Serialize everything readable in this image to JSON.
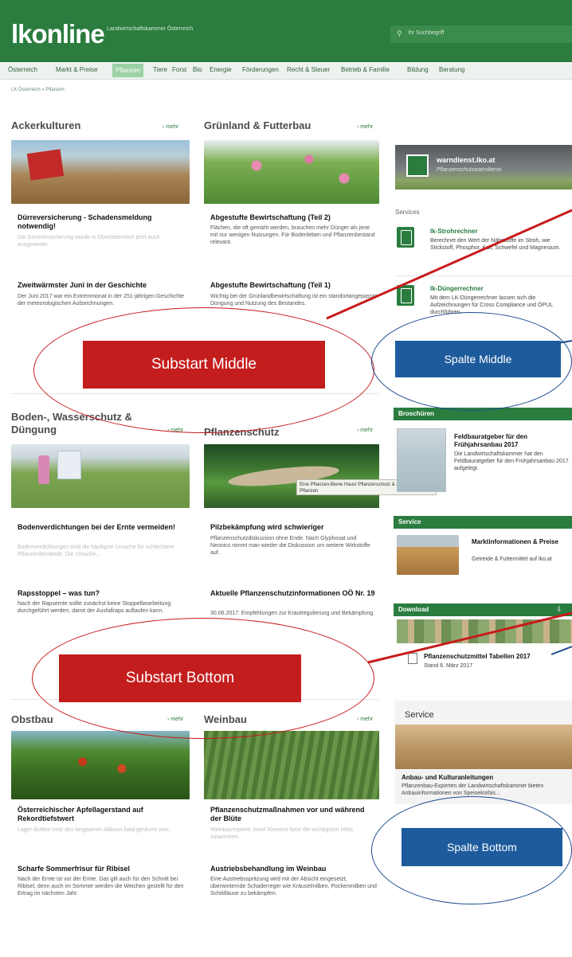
{
  "header": {
    "logo": "lkonline",
    "logo_sub": "Landwirtschaftskammer Österreich",
    "search_placeholder": "Ihr Suchbegriff"
  },
  "nav": {
    "items": [
      "Österreich",
      "Markt & Preise",
      "Pflanzen",
      "Tiere",
      "Forst",
      "Bio",
      "Energie",
      "Förderungen",
      "Recht & Steuer",
      "Betrieb & Familie",
      "Bildung",
      "Beratung"
    ],
    "active": "Pflanzen"
  },
  "breadcrumb": "LK Österreich » Pflanzen",
  "more_label": "› mehr",
  "sections": {
    "acker": {
      "title": "Ackerkulturen",
      "a1_title": "Dürreversicherung - Schadensmeldung notwendig!",
      "a1_desc": "Die Dürreversicherung wurde in Oberösterreich jetzt auch ausgeweitet.",
      "a2_title": "Zweitwärmster Juni in der Geschichte",
      "a2_desc": "Der Juni 2017 war ein Extremmonat in der 251-jährigen Geschichte der meteorologischen Aufzeichnungen."
    },
    "gruen": {
      "title": "Grünland & Futterbau",
      "a1_title": "Abgestufte Bewirtschaftung (Teil 2)",
      "a1_desc": "Flächen, die oft gemäht werden, brauchen mehr Dünger als jene mit nur wenigen Nutzungen. Für Bodenleben und Pflanzenbestand relevant.",
      "a2_title": "Abgestufte Bewirtschaftung (Teil 1)",
      "a2_desc": "Wichtig bei der Grünlandbewirtschaftung ist ein standortangepasste Düngung und Nutzung des Bestandes."
    },
    "boden": {
      "title": "Boden-, Wasserschutz & Düngung",
      "a1_title": "Bodenverdichtungen bei der Ernte vermeiden!",
      "a1_desc": "Bodenverdichtungen sind die häufigste Ursache für schlechtere Pflanzenbestände. Die Ursache...",
      "a2_title": "Rapsstoppel – was tun?",
      "a2_desc": "Nach der Rapsernte sollte zunächst keine Stoppelbearbeitung durchgeführt werden, damit der Ausfallraps auflaufen kann."
    },
    "pflanzenschutz": {
      "title": "Pflanzenschutz",
      "tooltip": "Eine Pflanzen-Biene Haus/ Pflanzenschutz & Dr. Hubert Pflanzen",
      "a1_title": "Pilzbekämpfung wird schwieriger",
      "a1_desc": "Pflanzenschutzdiskussion ohne Ende. Nach Glyphosat und Neonics nimmt man wieder die Diskussion um weitere Wirkstoffe auf.",
      "a2_title": "Aktuelle Pflanzenschutzinformationen OÖ Nr. 19",
      "a2_desc": "30.06.2017: Empfehlungen zur Krautregulierung und Bekämpfung"
    },
    "obst": {
      "title": "Obstbau",
      "a1_title": "Österreichischer Apfellagerstand auf Rekordtiefstwert",
      "a1_desc": "Lager dürften trotz des langsamen Abbaus bald geräumt sein.",
      "a2_title": "Scharfe Sommerfrisur für Ribisel",
      "a2_desc": "Nach der Ernte ist vor der Ernte. Das gilt auch für den Schnitt bei Ribisel, denn auch im Sommer werden die Weichen gestellt für den Ertrag im nächsten Jahr."
    },
    "wein": {
      "title": "Weinbau",
      "a1_title": "Pflanzenschutzmaßnahmen vor und während der Blüte",
      "a1_desc": "Weinbauexperte Josef Klement fasst die wichtigsten Infos zusammen.",
      "a2_title": "Austriebsbehandlung im Weinbau",
      "a2_desc": "Eine Austriebsspritzung wird mit der Absicht eingesetzt, überwinternde Schaderreger wie Kräuselmilben, Pockenmilben und Schildläuse zu bekämpfen."
    }
  },
  "sidebar": {
    "warn_title": "warndienst.lko.at",
    "warn_sub": "Pflanzenschutzwarndienst",
    "services_heading": "Services",
    "strohrechner_title": "lk-Strohrechner",
    "strohrechner_desc": "Berechnet den Wert der Nährstoffe im Stroh, wie Stickstoff, Phosphor, Kali, Schwefel und Magnesium.",
    "duenger_title": "lk-Düngerrechner",
    "duenger_desc": "Mit dem LK-Düngerrechner lassen sich die Aufzeichnungen für Cross Compliance und ÖPUL durchführen.",
    "broschueren_label": "Broschüren",
    "broschuere_title": "Feldbauratgeber für den Frühjahrsanbau 2017",
    "broschuere_desc": "Die Landwirtschaftskammer hat den Feldbauratgeber für den Frühjahrsanbau 2017 aufgelegt.",
    "service_label": "Service",
    "markt_title": "Marktinformationen & Preise",
    "markt_desc": "Getreide & Futtermittel auf lko.at",
    "download_label": "Download",
    "download_title": "Pflanzenschutzmittel Tabellen 2017",
    "download_desc": "Stand 6. März 2017",
    "service2_label": "Service",
    "anbau_title": "Anbau- und Kulturanleitungen",
    "anbau_desc": "Pflanzenbau-Experten der Landwirtschaftskammer bieten Anbauinformationen von Speisekürbis..."
  },
  "annotations": {
    "substart_middle": "Substart Middle",
    "spalte_middle": "Spalte Middle",
    "substart_bottom": "Substart Bottom",
    "spalte_bottom": "Spalte Bottom"
  },
  "colors": {
    "brand_green": "#2a7c3f",
    "annotation_red": "#c41d1d",
    "annotation_blue": "#1e5b9c"
  }
}
